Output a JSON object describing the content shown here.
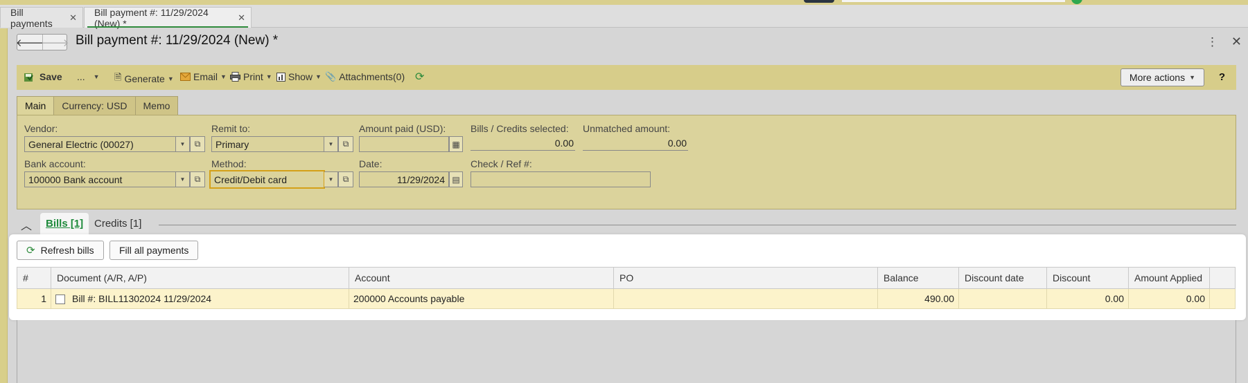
{
  "tabs": [
    {
      "label": "Bill payments"
    },
    {
      "label": "Bill payment #: 11/29/2024 (New) *"
    }
  ],
  "header": {
    "title": "Bill payment #: 11/29/2024 (New) *"
  },
  "toolbar": {
    "save": "Save",
    "ellipsis": "...",
    "generate": "Generate",
    "email": "Email",
    "print": "Print",
    "show": "Show",
    "attachments": "Attachments(0)",
    "more_actions": "More actions",
    "help": "?"
  },
  "form_tabs": [
    {
      "label": "Main"
    },
    {
      "label": "Currency: USD"
    },
    {
      "label": "Memo"
    }
  ],
  "form": {
    "vendor_label": "Vendor:",
    "vendor_value": "General Electric (00027)",
    "remit_label": "Remit to:",
    "remit_value": "Primary",
    "amount_paid_label": "Amount paid (USD):",
    "amount_paid_value": "",
    "bills_selected_label": "Bills / Credits selected:",
    "bills_selected_value": "0.00",
    "unmatched_label": "Unmatched amount:",
    "unmatched_value": "0.00",
    "bank_label": "Bank account:",
    "bank_value": "100000 Bank account",
    "method_label": "Method:",
    "method_value": "Credit/Debit card",
    "date_label": "Date:",
    "date_value": "11/29/2024",
    "check_label": "Check / Ref #:",
    "check_value": ""
  },
  "section_tabs": [
    {
      "label": "Bills [1]"
    },
    {
      "label": "Credits [1]"
    }
  ],
  "grid_buttons": {
    "refresh": "Refresh bills",
    "fill": "Fill all payments"
  },
  "grid": {
    "headers": [
      "#",
      "Document (A/R, A/P)",
      "Account",
      "PO",
      "Balance",
      "Discount date",
      "Discount",
      "Amount Applied"
    ],
    "rows": [
      {
        "num": "1",
        "document": "Bill #: BILL11302024 11/29/2024",
        "account": "200000 Accounts payable",
        "po": "",
        "balance": "490.00",
        "discount_date": "",
        "discount": "0.00",
        "amount_applied": "0.00"
      }
    ]
  },
  "colors": {
    "accent_green": "#2e8b3c",
    "panel_khaki": "#dbd39c",
    "toolbar_khaki": "#d7cd8a",
    "row_highlight": "#fcf3cb",
    "focus_outline": "#d4a018"
  }
}
